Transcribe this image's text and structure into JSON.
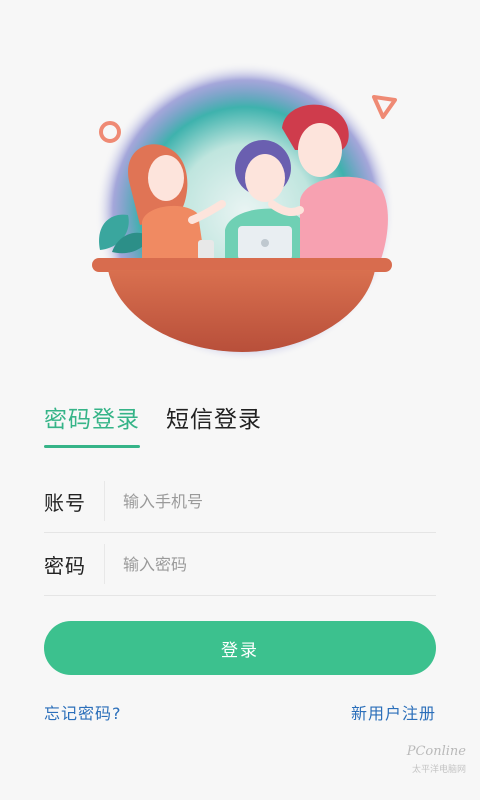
{
  "tabs": [
    {
      "label": "密码登录",
      "active": true
    },
    {
      "label": "短信登录",
      "active": false
    }
  ],
  "form": {
    "account_label": "账号",
    "account_placeholder": "输入手机号",
    "password_label": "密码",
    "password_placeholder": "输入密码"
  },
  "login_button": "登录",
  "links": {
    "forgot": "忘记密码?",
    "register": "新用户注册"
  },
  "watermark": {
    "brand": "PConline",
    "sub": "太平洋电脑网"
  },
  "colors": {
    "accent": "#36b488",
    "button": "#3cc18e",
    "link": "#2b6fba"
  }
}
